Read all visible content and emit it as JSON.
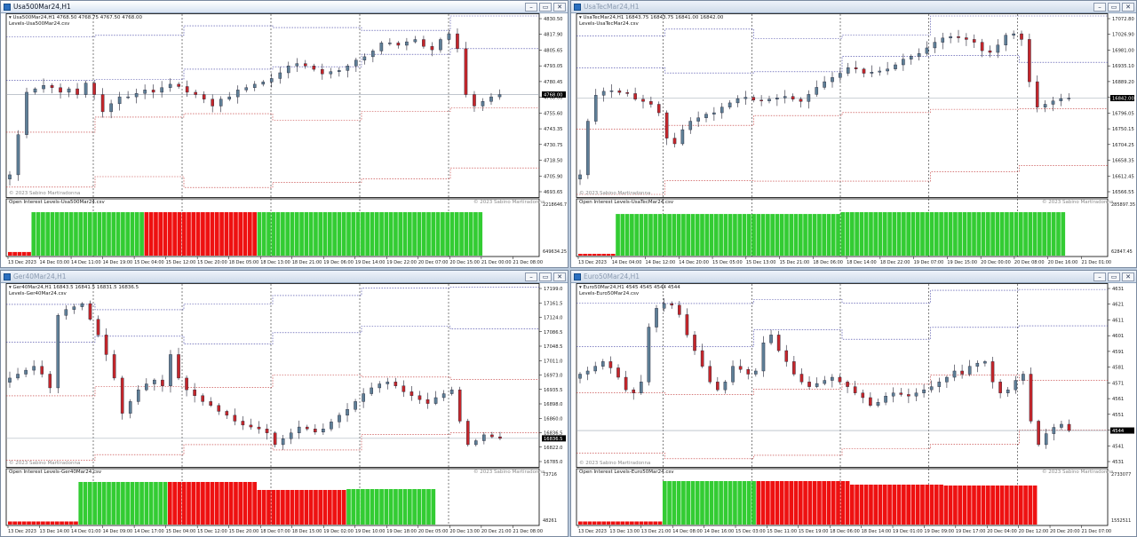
{
  "windows": [
    {
      "id": "usa500",
      "title": "Usa500Mar24,H1",
      "active": true,
      "header_line1": "Usa500Mar24,H1  4768.50 4768.75 4767.50 4768.00",
      "header_line2": "Levels-Usa500Mar24.csv",
      "oi_label": "Open Interest Levels-Usa500Mar24.csv",
      "copyright_main": "© 2023 Sabino Martiradonna",
      "copyright_sub": "© 2023 Sabino Martiradonna",
      "price_ticks": [
        "4830.50",
        "4817.90",
        "4805.65",
        "4793.05",
        "4780.45",
        "4768.00",
        "4755.60",
        "4743.35",
        "4730.75",
        "4718.50",
        "4705.90",
        "4693.65"
      ],
      "current_price": "4768.00",
      "oi_ticks": [
        "2218646.7",
        "649634.25"
      ],
      "time_ticks": [
        "13 Dec 2023",
        "14 Dec 03:00",
        "14 Dec 11:00",
        "14 Dec 19:00",
        "15 Dec 04:00",
        "15 Dec 12:00",
        "15 Dec 20:00",
        "18 Dec 05:00",
        "18 Dec 13:00",
        "18 Dec 21:00",
        "19 Dec 06:00",
        "19 Dec 14:00",
        "19 Dec 22:00",
        "20 Dec 07:00",
        "20 Dec 15:00",
        "21 Dec 00:00",
        "21 Dec 08:00"
      ],
      "chart_data": {
        "type": "candlestick",
        "close_path": [
          4700,
          4735,
          4772,
          4775,
          4778,
          4776,
          4772,
          4775,
          4770,
          4780,
          4770,
          4755,
          4762,
          4768,
          4768,
          4771,
          4774,
          4772,
          4776,
          4779,
          4777,
          4772,
          4770,
          4766,
          4760,
          4766,
          4768,
          4774,
          4776,
          4779,
          4781,
          4784,
          4789,
          4795,
          4797,
          4795,
          4792,
          4788,
          4790,
          4791,
          4795,
          4800,
          4803,
          4808,
          4815,
          4815,
          4813,
          4816,
          4818,
          4812,
          4809,
          4818,
          4823,
          4810,
          4770,
          4760,
          4764,
          4768,
          4770
        ],
        "oi_bars": [
          {
            "label": "interval-1",
            "start": 0,
            "end": 5,
            "value": 0.08,
            "color": "red"
          },
          {
            "label": "interval-2",
            "start": 5,
            "end": 29,
            "value": 0.96,
            "color": "green"
          },
          {
            "label": "interval-3",
            "start": 29,
            "end": 53,
            "value": 0.96,
            "color": "red"
          },
          {
            "label": "interval-4",
            "start": 53,
            "end": 101,
            "value": 0.96,
            "color": "green"
          }
        ]
      }
    },
    {
      "id": "usatec",
      "title": "UsaTecMar24,H1",
      "active": false,
      "header_line1": "UsaTecMar24,H1  16843.75 16843.75 16841.00 16842.00",
      "header_line2": "Levels-UsaTecMar24.csv",
      "oi_label": "Open Interest Levels-UsaTecMar24.csv",
      "copyright_main": "© 2023 Sabino Martiradonna",
      "copyright_sub": "© 2023 Sabino Martiradonna",
      "price_ticks": [
        "17072.80",
        "17026.90",
        "16981.00",
        "16935.10",
        "16889.20",
        "16842.00",
        "16796.05",
        "16750.15",
        "16704.25",
        "16658.35",
        "16612.45",
        "16566.55"
      ],
      "current_price": "16842.00",
      "oi_ticks": [
        "285897.35",
        "62847.45"
      ],
      "time_ticks": [
        "13 Dec 2023",
        "14 Dec 04:00",
        "14 Dec 12:00",
        "14 Dec 20:00",
        "15 Dec 05:00",
        "15 Dec 13:00",
        "15 Dec 21:00",
        "18 Dec 06:00",
        "18 Dec 14:00",
        "18 Dec 22:00",
        "19 Dec 07:00",
        "19 Dec 15:00",
        "20 Dec 00:00",
        "20 Dec 08:00",
        "20 Dec 16:00",
        "21 Dec 01:00"
      ],
      "chart_data": {
        "type": "candlestick",
        "close_path": [
          16570,
          16760,
          16852,
          16866,
          16868,
          16862,
          16858,
          16838,
          16830,
          16820,
          16790,
          16700,
          16680,
          16730,
          16760,
          16772,
          16785,
          16790,
          16810,
          16825,
          16840,
          16845,
          16835,
          16832,
          16838,
          16843,
          16848,
          16838,
          16830,
          16855,
          16880,
          16900,
          16915,
          16930,
          16950,
          16945,
          16930,
          16934,
          16938,
          16945,
          16960,
          16980,
          16990,
          17000,
          17020,
          17040,
          17055,
          17060,
          17056,
          17050,
          17040,
          17010,
          17004,
          17030,
          17065,
          17070,
          17050,
          16900,
          16810,
          16820,
          16832,
          16840,
          16842
        ],
        "oi_bars": [
          {
            "label": "interval-1",
            "start": 0,
            "end": 8,
            "value": 0.04,
            "color": "red"
          },
          {
            "label": "interval-2",
            "start": 8,
            "end": 56,
            "value": 0.92,
            "color": "green"
          },
          {
            "label": "interval-3",
            "start": 56,
            "end": 104,
            "value": 0.96,
            "color": "green"
          }
        ]
      }
    },
    {
      "id": "ger40",
      "title": "Ger40Mar24,H1",
      "active": false,
      "header_line1": "Ger40Mar24,H1  16843.5 16841.5 16831.5 16836.5",
      "header_line2": "Levels-Ger40Mar24.csv",
      "oi_label": "Open Interest Levels-Ger40Mar24.csv",
      "copyright_main": "© 2023 Sabino Martiradonna",
      "copyright_sub": "© 2023 Sabino Martiradonna",
      "price_ticks": [
        "17199.0",
        "17161.5",
        "17124.0",
        "17086.5",
        "17048.5",
        "17011.0",
        "16973.0",
        "16935.5",
        "16898.0",
        "16860.0",
        "16836.5",
        "16822.0",
        "16785.0"
      ],
      "current_price": "16836.5",
      "oi_ticks": [
        "73716",
        "48261"
      ],
      "time_ticks": [
        "13 Dec 2023",
        "13 Dec 14:00",
        "14 Dec 01:00",
        "14 Dec 09:00",
        "14 Dec 17:00",
        "15 Dec 04:00",
        "15 Dec 12:00",
        "15 Dec 20:00",
        "18 Dec 07:00",
        "18 Dec 15:00",
        "19 Dec 02:00",
        "19 Dec 10:00",
        "19 Dec 18:00",
        "20 Dec 05:00",
        "20 Dec 13:00",
        "20 Dec 21:00",
        "21 Dec 08:00"
      ],
      "chart_data": {
        "type": "candlestick",
        "close_path": [
          16990,
          17000,
          17010,
          17020,
          17000,
          16965,
          17150,
          17165,
          17172,
          17180,
          17140,
          17100,
          17050,
          16990,
          16900,
          16930,
          16960,
          16975,
          16985,
          16970,
          17050,
          16990,
          16960,
          16945,
          16930,
          16920,
          16905,
          16895,
          16880,
          16870,
          16865,
          16860,
          16850,
          16820,
          16835,
          16850,
          16865,
          16860,
          16852,
          16860,
          16878,
          16895,
          16910,
          16930,
          16950,
          16965,
          16975,
          16980,
          16970,
          16955,
          16945,
          16935,
          16925,
          16940,
          16950,
          16960,
          16880,
          16820,
          16830,
          16845,
          16840,
          16836
        ],
        "oi_bars": [
          {
            "label": "interval-1",
            "start": 0,
            "end": 15,
            "value": 0.07,
            "color": "red"
          },
          {
            "label": "interval-2",
            "start": 15,
            "end": 34,
            "value": 0.96,
            "color": "green"
          },
          {
            "label": "interval-3",
            "start": 34,
            "end": 53,
            "value": 0.96,
            "color": "red"
          },
          {
            "label": "interval-4",
            "start": 53,
            "end": 72,
            "value": 0.78,
            "color": "red"
          },
          {
            "label": "interval-5",
            "start": 72,
            "end": 91,
            "value": 0.8,
            "color": "green"
          }
        ]
      }
    },
    {
      "id": "euro50",
      "title": "Euro50Mar24,H1",
      "active": false,
      "header_line1": "Euro50Mar24,H1  4545 4545 4544 4544",
      "header_line2": "Levels-Euro50Mar24.csv",
      "oi_label": "Open Interest Levels-Euro50Mar24.csv",
      "copyright_main": "© 2023 Sabino Martiradonna",
      "copyright_sub": "© 2023 Sabino Martiradonna",
      "price_ticks": [
        "4631",
        "4621",
        "4611",
        "4601",
        "4591",
        "4581",
        "4571",
        "4561",
        "4551",
        "4544",
        "4541",
        "4531"
      ],
      "current_price": "4544",
      "oi_ticks": [
        "2733077",
        "1552511"
      ],
      "time_ticks": [
        "13 Dec 2023",
        "13 Dec 13:00",
        "13 Dec 21:00",
        "14 Dec 08:00",
        "14 Dec 16:00",
        "15 Dec 03:00",
        "15 Dec 11:00",
        "15 Dec 19:00",
        "18 Dec 06:00",
        "18 Dec 14:00",
        "19 Dec 01:00",
        "19 Dec 09:00",
        "19 Dec 17:00",
        "20 Dec 04:00",
        "20 Dec 12:00",
        "20 Dec 20:00",
        "21 Dec 07:00"
      ],
      "chart_data": {
        "type": "candlestick",
        "close_path": [
          4580,
          4582,
          4585,
          4588,
          4584,
          4578,
          4570,
          4568,
          4575,
          4610,
          4622,
          4625,
          4624,
          4618,
          4605,
          4595,
          4585,
          4575,
          4570,
          4575,
          4585,
          4583,
          4580,
          4582,
          4600,
          4605,
          4595,
          4588,
          4580,
          4575,
          4572,
          4574,
          4576,
          4578,
          4575,
          4572,
          4568,
          4565,
          4560,
          4562,
          4566,
          4568,
          4567,
          4566,
          4568,
          4570,
          4572,
          4575,
          4578,
          4582,
          4580,
          4585,
          4587,
          4588,
          4575,
          4568,
          4570,
          4576,
          4580,
          4550,
          4535,
          4542,
          4546,
          4548,
          4544
        ],
        "oi_bars": [
          {
            "label": "interval-1",
            "start": 0,
            "end": 18,
            "value": 0.07,
            "color": "red"
          },
          {
            "label": "interval-2",
            "start": 18,
            "end": 38,
            "value": 0.98,
            "color": "green"
          },
          {
            "label": "interval-3",
            "start": 38,
            "end": 58,
            "value": 0.98,
            "color": "red"
          },
          {
            "label": "interval-4",
            "start": 58,
            "end": 78,
            "value": 0.9,
            "color": "red"
          },
          {
            "label": "interval-5",
            "start": 78,
            "end": 98,
            "value": 0.88,
            "color": "red"
          }
        ]
      }
    }
  ]
}
